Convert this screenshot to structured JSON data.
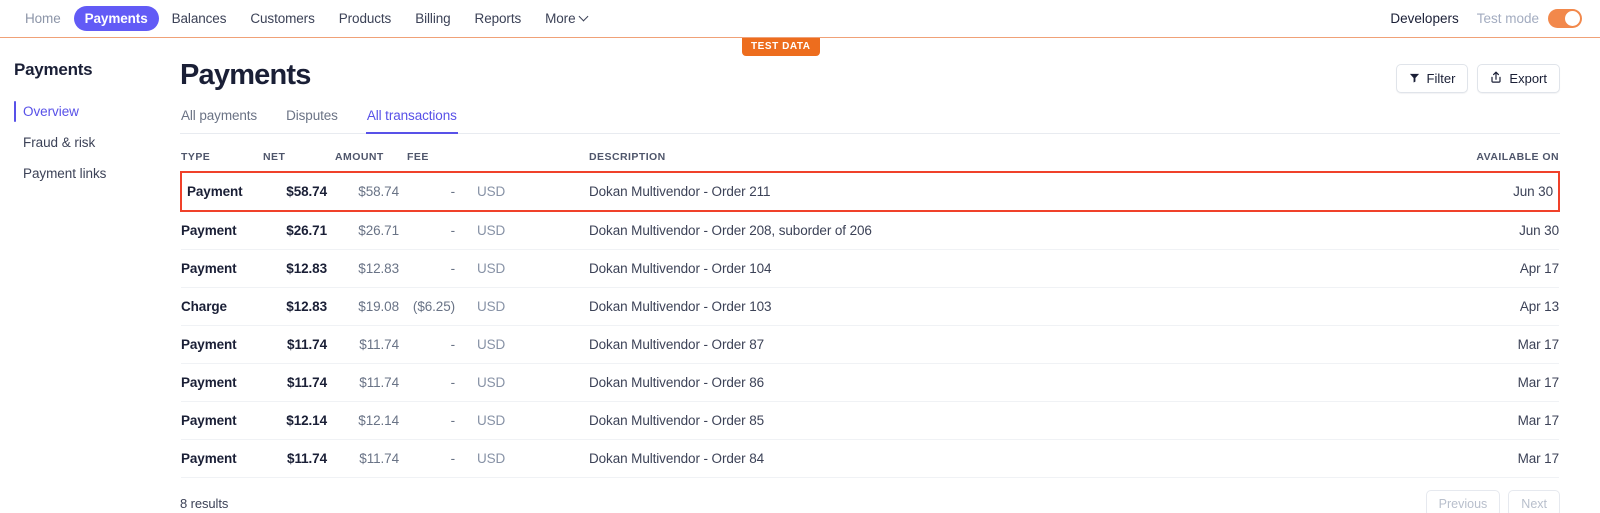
{
  "topnav": {
    "items": [
      {
        "label": "Home",
        "active": false,
        "muted": true
      },
      {
        "label": "Payments",
        "active": true,
        "muted": false
      },
      {
        "label": "Balances",
        "active": false,
        "muted": false
      },
      {
        "label": "Customers",
        "active": false,
        "muted": false
      },
      {
        "label": "Products",
        "active": false,
        "muted": false
      },
      {
        "label": "Billing",
        "active": false,
        "muted": false
      },
      {
        "label": "Reports",
        "active": false,
        "muted": false
      },
      {
        "label": "More",
        "active": false,
        "muted": false
      }
    ],
    "developers_label": "Developers",
    "test_mode_label": "Test mode",
    "test_mode_on": true,
    "accent_color": "#625bf6",
    "test_accent_color": "#f2884b"
  },
  "test_data_badge": "TEST DATA",
  "sidebar": {
    "title": "Payments",
    "items": [
      {
        "label": "Overview",
        "active": true
      },
      {
        "label": "Fraud & risk",
        "active": false
      },
      {
        "label": "Payment links",
        "active": false
      }
    ]
  },
  "header": {
    "title": "Payments",
    "filter_label": "Filter",
    "export_label": "Export"
  },
  "tabs": [
    {
      "label": "All payments",
      "active": false
    },
    {
      "label": "Disputes",
      "active": false
    },
    {
      "label": "All transactions",
      "active": true
    }
  ],
  "table": {
    "columns": {
      "type": "TYPE",
      "net": "NET",
      "amount": "AMOUNT",
      "fee": "FEE",
      "currency": "",
      "description": "DESCRIPTION",
      "available_on": "AVAILABLE ON"
    },
    "rows": [
      {
        "type": "Payment",
        "net": "$58.74",
        "amount": "$58.74",
        "fee": "-",
        "currency": "USD",
        "description": "Dokan Multivendor - Order 211",
        "available_on": "Jun 30",
        "highlighted": true
      },
      {
        "type": "Payment",
        "net": "$26.71",
        "amount": "$26.71",
        "fee": "-",
        "currency": "USD",
        "description": "Dokan Multivendor - Order 208, suborder of 206",
        "available_on": "Jun 30",
        "highlighted": false
      },
      {
        "type": "Payment",
        "net": "$12.83",
        "amount": "$12.83",
        "fee": "-",
        "currency": "USD",
        "description": "Dokan Multivendor - Order 104",
        "available_on": "Apr 17",
        "highlighted": false
      },
      {
        "type": "Charge",
        "net": "$12.83",
        "amount": "$19.08",
        "fee": "($6.25)",
        "currency": "USD",
        "description": "Dokan Multivendor - Order 103",
        "available_on": "Apr 13",
        "highlighted": false
      },
      {
        "type": "Payment",
        "net": "$11.74",
        "amount": "$11.74",
        "fee": "-",
        "currency": "USD",
        "description": "Dokan Multivendor - Order 87",
        "available_on": "Mar 17",
        "highlighted": false
      },
      {
        "type": "Payment",
        "net": "$11.74",
        "amount": "$11.74",
        "fee": "-",
        "currency": "USD",
        "description": "Dokan Multivendor - Order 86",
        "available_on": "Mar 17",
        "highlighted": false
      },
      {
        "type": "Payment",
        "net": "$12.14",
        "amount": "$12.14",
        "fee": "-",
        "currency": "USD",
        "description": "Dokan Multivendor - Order 85",
        "available_on": "Mar 17",
        "highlighted": false
      },
      {
        "type": "Payment",
        "net": "$11.74",
        "amount": "$11.74",
        "fee": "-",
        "currency": "USD",
        "description": "Dokan Multivendor - Order 84",
        "available_on": "Mar 17",
        "highlighted": false
      }
    ]
  },
  "footer": {
    "results": "8 results",
    "previous_label": "Previous",
    "next_label": "Next"
  },
  "highlight_color": "#f0412a"
}
